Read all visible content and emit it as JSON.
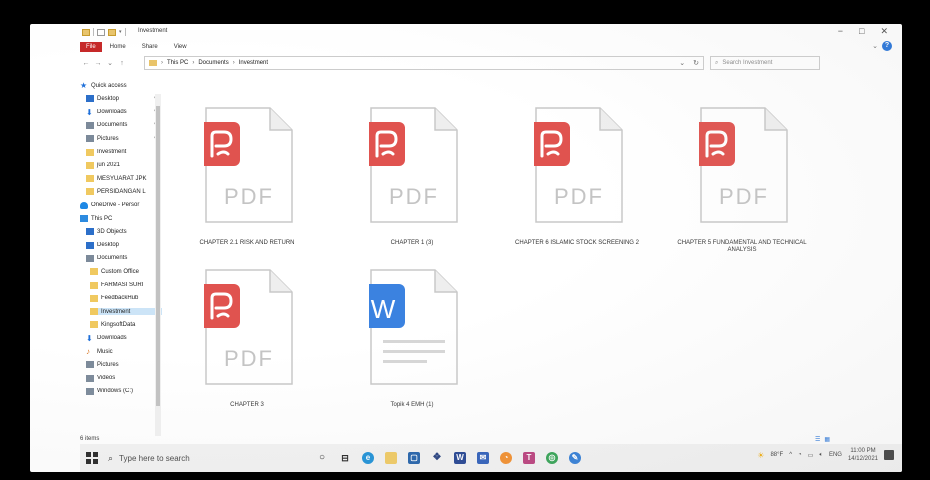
{
  "window": {
    "title": "Investment",
    "minimize": "−",
    "maximize": "□",
    "close": "✕"
  },
  "ribbon": {
    "tabs": [
      "File",
      "Home",
      "Share",
      "View"
    ],
    "expand": "⌄",
    "help": "?"
  },
  "address": {
    "nav_back": "←",
    "nav_forward": "→",
    "nav_recent": "⌄",
    "nav_up": "↑",
    "crumbs": [
      "This PC",
      "Documents",
      "Investment"
    ],
    "dropdown": "⌄",
    "refresh": "↻",
    "search_placeholder": "Search Investment"
  },
  "navpane": {
    "items": [
      {
        "label": "Quick access",
        "icon": "star-icon"
      },
      {
        "label": "Desktop",
        "icon": "desktop-icon",
        "pinned": true
      },
      {
        "label": "Downloads",
        "icon": "download-icon",
        "pinned": true
      },
      {
        "label": "Documents",
        "icon": "documents-icon",
        "pinned": true
      },
      {
        "label": "Pictures",
        "icon": "pictures-icon",
        "pinned": true
      },
      {
        "label": "Investment",
        "icon": "folder-icon"
      },
      {
        "label": "jun 2021",
        "icon": "folder-icon"
      },
      {
        "label": "MESYUARAT JPK",
        "icon": "folder-icon"
      },
      {
        "label": "PERSIDANGAN L",
        "icon": "folder-icon"
      },
      {
        "label": "OneDrive - Persor",
        "icon": "cloud-icon"
      },
      {
        "label": "This PC",
        "icon": "pc-icon"
      },
      {
        "label": "3D Objects",
        "icon": "cube-icon"
      },
      {
        "label": "Desktop",
        "icon": "desktop-icon"
      },
      {
        "label": "Documents",
        "icon": "documents-icon"
      },
      {
        "label": "Custom Office",
        "icon": "folder-icon"
      },
      {
        "label": "FARMASI SURI",
        "icon": "folder-icon"
      },
      {
        "label": "FeedbackHub",
        "icon": "folder-icon"
      },
      {
        "label": "Investment",
        "icon": "folder-icon",
        "selected": true
      },
      {
        "label": "KingsoftData",
        "icon": "folder-icon"
      },
      {
        "label": "Downloads",
        "icon": "download-icon"
      },
      {
        "label": "Music",
        "icon": "music-icon"
      },
      {
        "label": "Pictures",
        "icon": "pictures-icon"
      },
      {
        "label": "Videos",
        "icon": "videos-icon"
      },
      {
        "label": "Windows (C:)",
        "icon": "drive-icon"
      }
    ],
    "pin_glyph": "✎"
  },
  "files": [
    {
      "name": "CHAPTER 2.1 RISK AND RETURN",
      "type": "PDF"
    },
    {
      "name": "CHAPTER 1 (3)",
      "type": "PDF"
    },
    {
      "name": "CHAPTER 6 ISLAMIC STOCK SCREENING 2",
      "type": "PDF"
    },
    {
      "name": "CHAPTER 5 FUNDAMENTAL AND TECHNICAL ANALYSIS",
      "type": "PDF"
    },
    {
      "name": "CHAPTER 3",
      "type": "PDF"
    },
    {
      "name": "Topik 4 EMH (1)",
      "type": "W"
    }
  ],
  "status": {
    "item_count": "6 items"
  },
  "taskbar": {
    "search_placeholder": "Type here to search",
    "weather": "88°F",
    "language": "ENG",
    "time": "11:00 PM",
    "date": "14/12/2021"
  },
  "colors": {
    "pdf_red": "#e0534f",
    "word_blue": "#3b82e0",
    "file_tab_red": "#c62828"
  }
}
